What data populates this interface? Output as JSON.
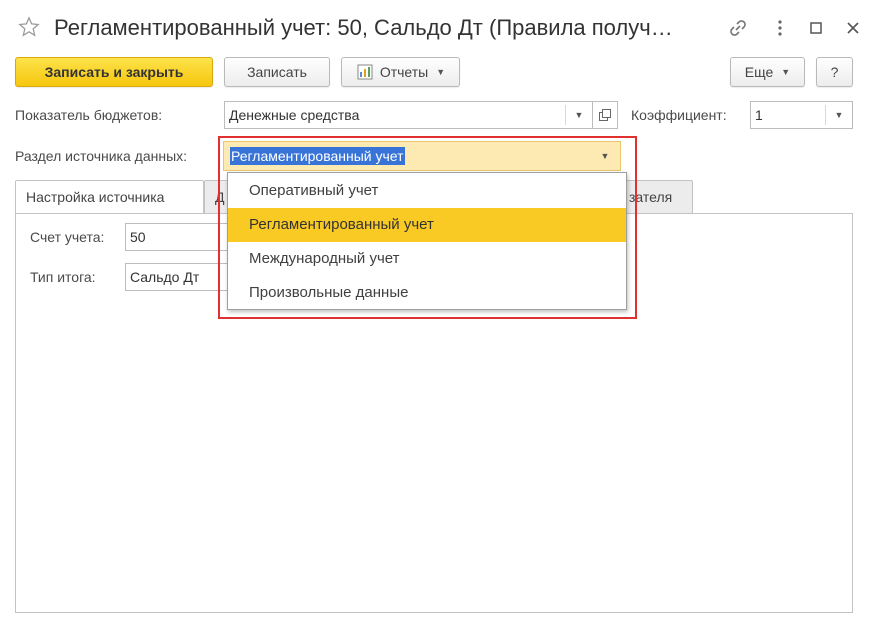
{
  "window": {
    "title": "Регламентированный учет: 50, Сальдо Дт (Правила получ…",
    "icons": [
      "star-icon",
      "link-icon",
      "more-icon",
      "maximize-icon",
      "close-icon"
    ]
  },
  "toolbar": {
    "save_close_label": "Записать и закрыть",
    "save_label": "Записать",
    "reports_label": "Отчеты",
    "more_label": "Еще",
    "help_label": "?"
  },
  "form": {
    "budget_indicator_label": "Показатель бюджетов:",
    "budget_indicator_value": "Денежные средства",
    "coefficient_label": "Коэффициент:",
    "coefficient_value": "1",
    "data_source_label": "Раздел источника данных:",
    "data_source_value": "Регламентированный учет"
  },
  "dropdown": {
    "options": [
      {
        "label": "Оперативный учет",
        "selected": false
      },
      {
        "label": "Регламентированный учет",
        "selected": true
      },
      {
        "label": "Международный учет",
        "selected": false
      },
      {
        "label": "Произвольные данные",
        "selected": false
      }
    ]
  },
  "tabs": [
    {
      "label": "Настройка источника",
      "active": true
    },
    {
      "label": "Д",
      "active": false
    },
    {
      "label": "зателя",
      "active": false
    }
  ],
  "source_settings": {
    "account_label": "Счет учета:",
    "account_value": "50",
    "total_type_label": "Тип итога:",
    "total_type_value": "Сальдо Дт"
  },
  "colors": {
    "primary_button": "#f6c70e",
    "selected_option": "#f9ca23",
    "text_selection": "#3874d8",
    "highlight_frame": "#e03030",
    "focused_field": "#fde9b2"
  }
}
